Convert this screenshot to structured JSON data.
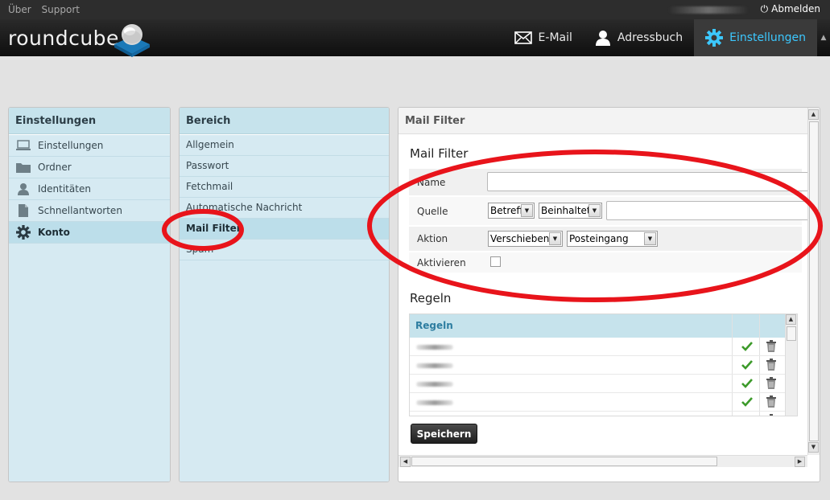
{
  "topbar": {
    "links": [
      "Über",
      "Support"
    ],
    "logout_label": "Abmelden"
  },
  "header": {
    "logo_text": "roundcube",
    "nav": [
      {
        "label": "E-Mail",
        "icon": "envelope-icon"
      },
      {
        "label": "Adressbuch",
        "icon": "person-icon"
      },
      {
        "label": "Einstellungen",
        "icon": "gear-icon",
        "active": true
      }
    ]
  },
  "settings_panel": {
    "title": "Einstellungen",
    "items": [
      {
        "label": "Einstellungen",
        "icon": "laptop-icon"
      },
      {
        "label": "Ordner",
        "icon": "folder-icon"
      },
      {
        "label": "Identitäten",
        "icon": "identity-icon"
      },
      {
        "label": "Schnellantworten",
        "icon": "document-icon"
      },
      {
        "label": "Konto",
        "icon": "gear-icon",
        "selected": true
      }
    ]
  },
  "sections_panel": {
    "title": "Bereich",
    "items": [
      {
        "label": "Allgemein"
      },
      {
        "label": "Passwort"
      },
      {
        "label": "Fetchmail"
      },
      {
        "label": "Automatische Nachricht"
      },
      {
        "label": "Mail Filter",
        "selected": true
      },
      {
        "label": "Spam"
      }
    ]
  },
  "content": {
    "header_title": "Mail Filter",
    "form_title": "Mail Filter",
    "form": {
      "name_label": "Name",
      "name_value": "",
      "source_label": "Quelle",
      "source_field": "Betreff",
      "source_operator": "Beinhaltet",
      "source_value": "",
      "action_label": "Aktion",
      "action_type": "Verschieben",
      "action_target": "Posteingang",
      "enable_label": "Aktivieren",
      "enable_checked": false
    },
    "rules_title": "Regeln",
    "rules_table": {
      "header": "Regeln",
      "row_count_visible": 5
    },
    "save_label": "Speichern"
  },
  "colors": {
    "accent": "#3cc8ff",
    "panel_header": "#c6e3ec",
    "panel_body": "#d6eaf2",
    "annotation": "#e8141b"
  }
}
